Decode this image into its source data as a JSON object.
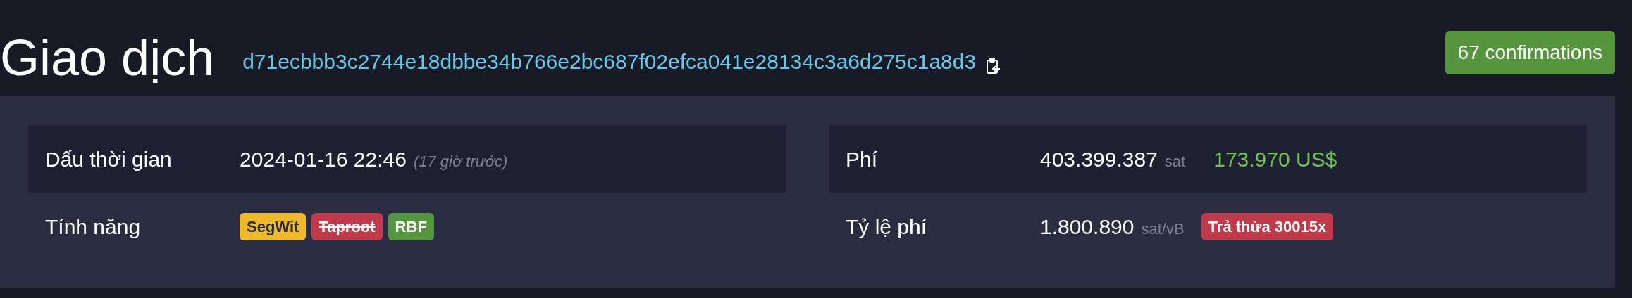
{
  "header": {
    "title": "Giao dịch",
    "txid": "d71ecbbb3c2744e18dbbe34b766e2bc687f02efca041e28134c3a6d275c1a8d3",
    "confirmations": "67 confirmations"
  },
  "left_table": [
    {
      "kind": "time",
      "label": "Dấu thời gian",
      "value": "2024-01-16 22:46",
      "note": "(17 giờ trước)"
    },
    {
      "kind": "features",
      "label": "Tính năng",
      "features": [
        {
          "label": "SegWit",
          "color": "#f0b92c",
          "enabled": true
        },
        {
          "label": "Taproot",
          "color": "#c13a4b",
          "enabled": false
        },
        {
          "label": "RBF",
          "color": "#55953e",
          "enabled": true
        }
      ]
    }
  ],
  "right_table": [
    {
      "kind": "amount",
      "label": "Phí",
      "value": "403.399.387",
      "unit": "sat",
      "fiat": "173.970 US$"
    },
    {
      "kind": "rate",
      "label": "Tỷ lệ phí",
      "value": "1.800.890",
      "unit": "sat/vB",
      "badge": "Trả thừa 30015x"
    }
  ]
}
